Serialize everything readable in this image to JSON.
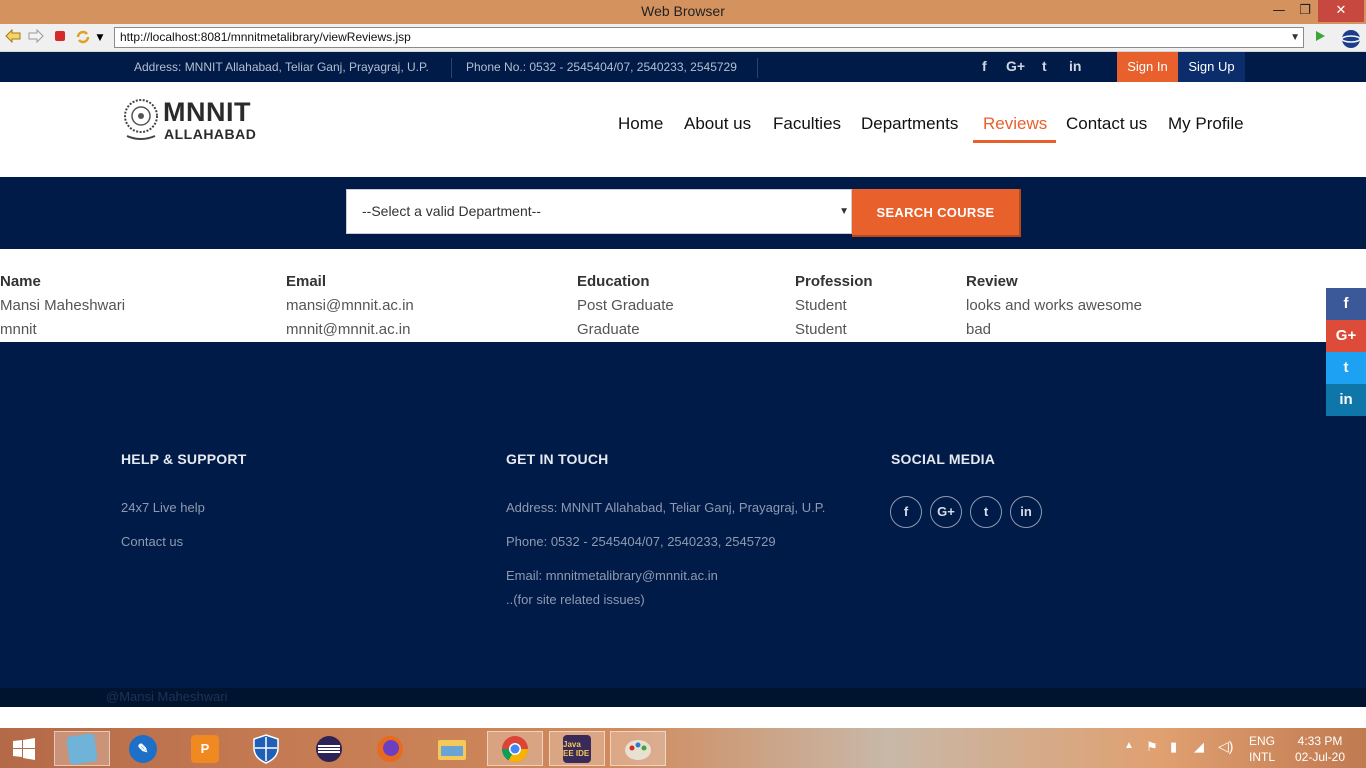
{
  "browser": {
    "title": "Web Browser",
    "minimize": "—",
    "maximize": "❐",
    "close": "✕",
    "url": "http://localhost:8081/mnnitmetalibrary/viewReviews.jsp"
  },
  "topbar": {
    "address": "Address: MNNIT Allahabad, Teliar Ganj, Prayagraj, U.P.",
    "phone": "Phone No.: 0532 - 2545404/07, 2540233, 2545729",
    "social": [
      "f",
      "G+",
      "t",
      "in"
    ],
    "signin": "Sign In",
    "signup": "Sign Up"
  },
  "logo": {
    "main": "MNNIT",
    "sub": "ALLAHABAD"
  },
  "nav": {
    "items": [
      "Home",
      "About us",
      "Faculties",
      "Departments",
      "Reviews",
      "Contact us",
      "My Profile"
    ],
    "active": "Reviews"
  },
  "search": {
    "selected": "--Select a valid Department--",
    "button": "SEARCH COURSE"
  },
  "reviews": {
    "headers": [
      "Name",
      "Email",
      "Education",
      "Profession",
      "Review"
    ],
    "rows": [
      [
        "Mansi Maheshwari",
        "mansi@mnnit.ac.in",
        "Post Graduate",
        "Student",
        "looks and works awesome"
      ],
      [
        "mnnit",
        "mnnit@mnnit.ac.in",
        "Graduate",
        "Student",
        "bad"
      ]
    ]
  },
  "float_social": [
    "f",
    "G+",
    "t",
    "in"
  ],
  "footer": {
    "help_title": "HELP & SUPPORT",
    "help_links": [
      "24x7 Live help",
      "Contact us"
    ],
    "touch_title": "GET IN TOUCH",
    "touch_address": "Address: MNNIT Allahabad, Teliar Ganj, Prayagraj, U.P.",
    "touch_phone": "Phone: 0532 - 2545404/07, 2540233, 2545729",
    "touch_email": "Email: mnnitmetalibrary@mnnit.ac.in",
    "touch_note": "..(for site related issues)",
    "social_title": "SOCIAL MEDIA",
    "social": [
      "f",
      "G+",
      "t",
      "in"
    ],
    "copyright": "@Mansi Maheshwari"
  },
  "taskbar": {
    "lang": "ENG",
    "layout": "INTL",
    "time": "4:33 PM",
    "date": "02-Jul-20"
  },
  "colors": {
    "navy": "#001b48",
    "accent": "#e8602c"
  }
}
